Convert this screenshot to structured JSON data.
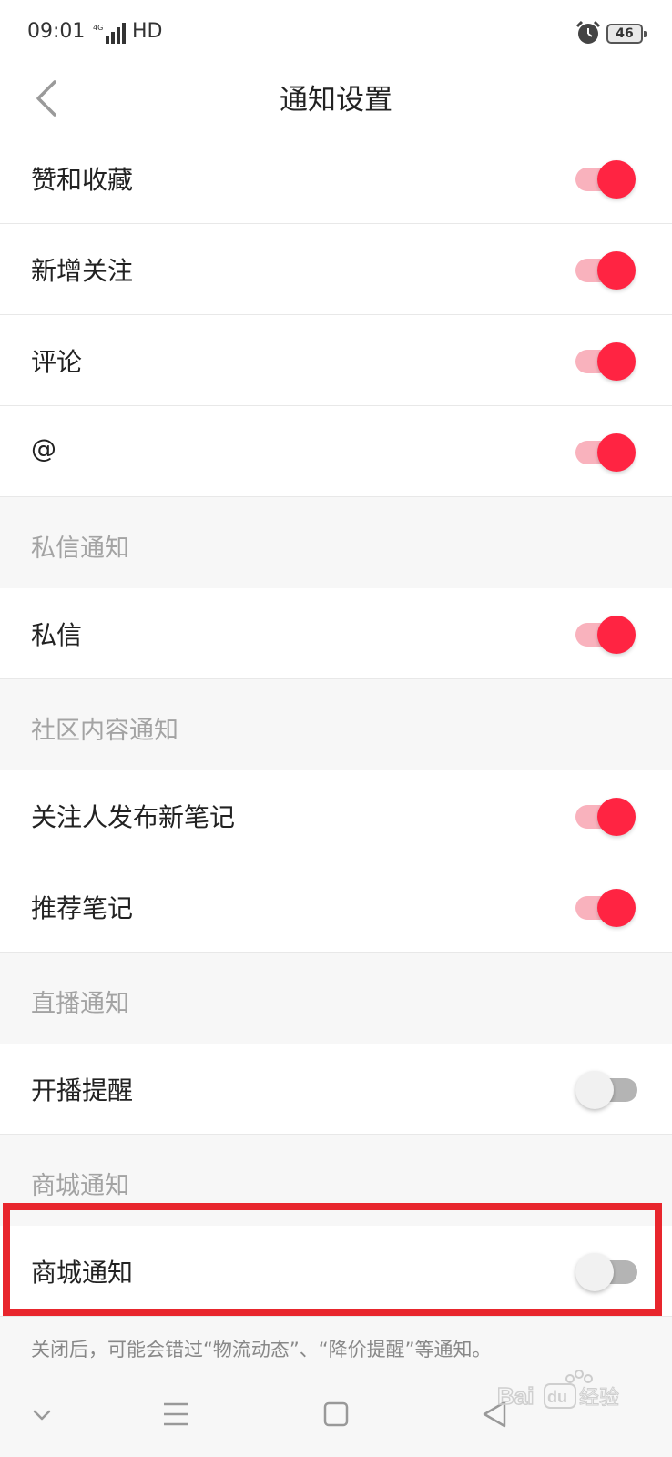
{
  "status_bar": {
    "time": "09:01",
    "network": "HD",
    "battery": "46"
  },
  "header": {
    "title": "通知设置"
  },
  "items": [
    {
      "kind": "row",
      "label": "赞和收藏",
      "on": true
    },
    {
      "kind": "row",
      "label": "新增关注",
      "on": true
    },
    {
      "kind": "row",
      "label": "评论",
      "on": true
    },
    {
      "kind": "row",
      "label": "@",
      "on": true
    },
    {
      "kind": "section",
      "label": "私信通知"
    },
    {
      "kind": "row",
      "label": "私信",
      "on": true
    },
    {
      "kind": "section",
      "label": "社区内容通知"
    },
    {
      "kind": "row",
      "label": "关注人发布新笔记",
      "on": true
    },
    {
      "kind": "row",
      "label": "推荐笔记",
      "on": true
    },
    {
      "kind": "section",
      "label": "直播通知"
    },
    {
      "kind": "row",
      "label": "开播提醒",
      "on": false
    },
    {
      "kind": "section",
      "label": "商城通知"
    },
    {
      "kind": "row",
      "label": "商城通知",
      "on": false
    }
  ],
  "footer_note": "关闭后，可能会错过“物流动态”、“降价提醒”等通知。",
  "watermark": "Baidu经验",
  "colors": {
    "accent": "#ff2442",
    "accent_track": "#f9b2bd",
    "highlight_box": "#e8262d"
  }
}
